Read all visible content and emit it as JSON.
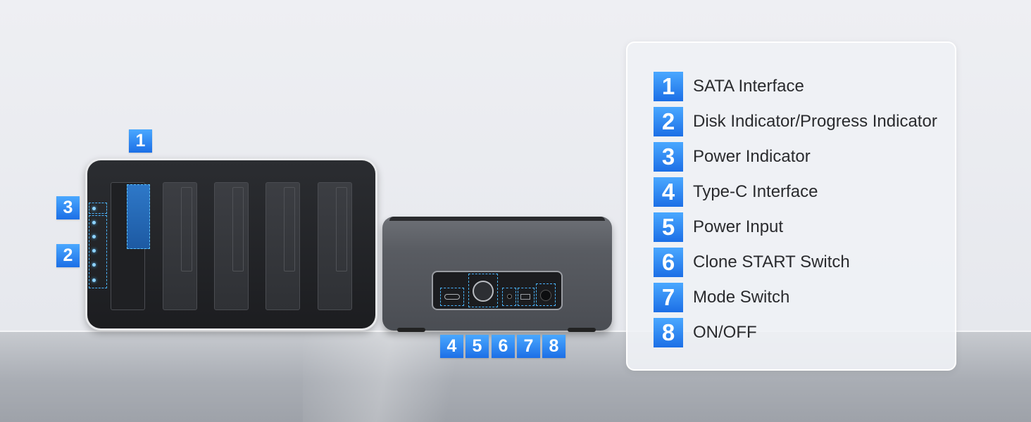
{
  "badges": {
    "sata": "1",
    "disk_indicator": "2",
    "power_indicator": "3",
    "type_c": "4",
    "power_input": "5",
    "clone_start": "6",
    "mode_switch": "7",
    "on_off": "8"
  },
  "legend": {
    "items": [
      {
        "number": "1",
        "label": "SATA Interface"
      },
      {
        "number": "2",
        "label": "Disk Indicator/Progress Indicator"
      },
      {
        "number": "3",
        "label": "Power Indicator"
      },
      {
        "number": "4",
        "label": "Type-C Interface"
      },
      {
        "number": "5",
        "label": "Power Input"
      },
      {
        "number": "6",
        "label": "Clone START Switch"
      },
      {
        "number": "7",
        "label": "Mode Switch"
      },
      {
        "number": "8",
        "label": "ON/OFF"
      }
    ]
  },
  "colors": {
    "accent": "#1c6fe6",
    "accent_light": "#4aa8ff",
    "highlight_dash": "#4ab3ff",
    "device_dark": "#1c1d20",
    "device_gray": "#595c62",
    "text": "#2a2b2e"
  }
}
